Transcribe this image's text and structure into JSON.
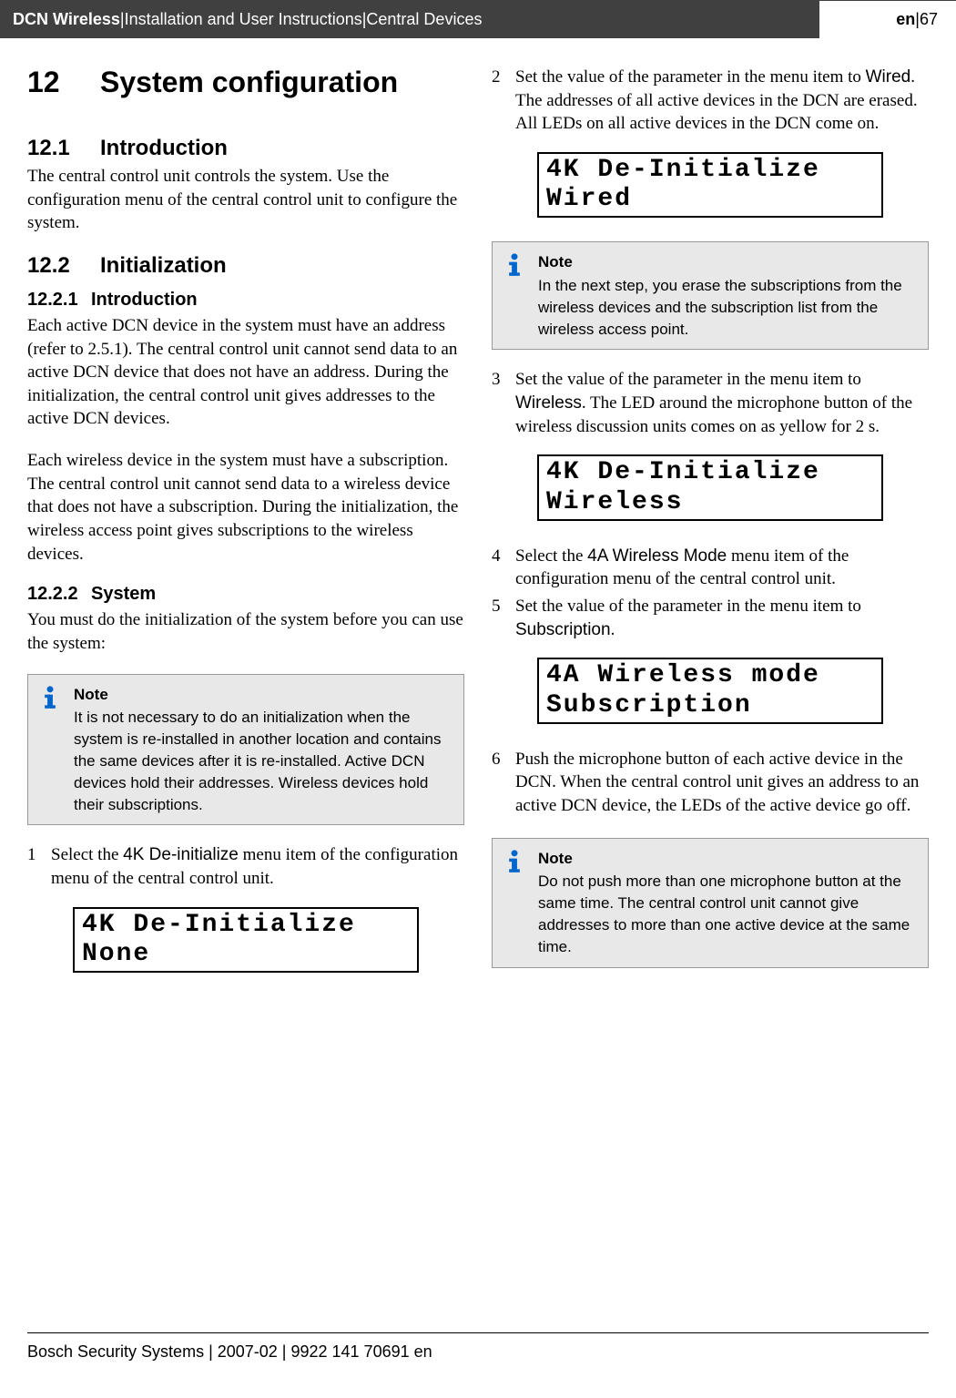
{
  "header": {
    "product": "DCN Wireless",
    "sep1": " | ",
    "doc_title": "Installation and User Instructions",
    "sep2": " | ",
    "section": "Central Devices",
    "lang": "en",
    "sep3": " | ",
    "page": "67"
  },
  "h1_num": "12",
  "h1_text": "System configuration",
  "h2_1_num": "12.1",
  "h2_1_text": "Introduction",
  "p_intro": "The central control unit controls the system. Use the configuration menu of the central control unit to configure the system.",
  "h2_2_num": "12.2",
  "h2_2_text": "Initialization",
  "h3_1_num": "12.2.1",
  "h3_1_text": "Introduction",
  "p_init1": "Each active DCN device in the system must have an address (refer to 2.5.1). The central control unit cannot send data to an active DCN device that does not have an address. During the initialization, the central control unit gives addresses to the active DCN devices.",
  "p_init2": "Each wireless device in the system must have a subscription. The central control unit cannot send data to a wireless device that does not have a subscription. During the initialization, the wireless access point gives subscriptions to the wireless devices.",
  "h3_2_num": "12.2.2",
  "h3_2_text": "System",
  "p_system": "You must do the initialization of the system before you can use the system:",
  "note1_title": "Note",
  "note1_text": "It is not necessary to do an initialization when the system is re-installed in another location and contains the same devices after it is re-installed. Active DCN devices hold their addresses. Wireless devices hold their subscriptions.",
  "step1_num": "1",
  "step1_text_a": "Select the ",
  "step1_text_b": "4K De-initialize",
  "step1_text_c": " menu item of the configuration menu of the central control unit.",
  "lcd1": "4K De-Initialize\nNone",
  "step2_num": "2",
  "step2_text_a": "Set the value of the parameter in the menu item to ",
  "step2_text_b": "Wired",
  "step2_text_c": ". The addresses of all active devices in the DCN are erased. All LEDs on all active devices in the DCN come on.",
  "lcd2": "4K De-Initialize\nWired",
  "note2_title": "Note",
  "note2_text": "In the next step, you erase the subscriptions from the wireless devices and the subscription list from the wireless access point.",
  "step3_num": "3",
  "step3_text_a": "Set the value of the parameter in the menu item to ",
  "step3_text_b": "Wireless",
  "step3_text_c": ". The LED around the microphone button of the wireless discussion units comes on as yellow for 2 s.",
  "lcd3": "4K De-Initialize\nWireless",
  "step4_num": "4",
  "step4_text_a": "Select the ",
  "step4_text_b": "4A Wireless Mode",
  "step4_text_c": " menu item of the configuration menu of the central control unit.",
  "step5_num": "5",
  "step5_text_a": "Set the value of the parameter in the menu item to ",
  "step5_text_b": "Subscription",
  "step5_text_c": ".",
  "lcd4": "4A Wireless mode\nSubscription",
  "step6_num": "6",
  "step6_text": "Push the microphone button of each active device in the DCN. When the central control unit gives an address to an active DCN device, the LEDs of the active device go off.",
  "note3_title": "Note",
  "note3_text": "Do not push more than one microphone button at the same time. The central control unit cannot give addresses to more than one active device at the same time.",
  "footer": "Bosch Security Systems | 2007-02 | 9922 141 70691 en"
}
